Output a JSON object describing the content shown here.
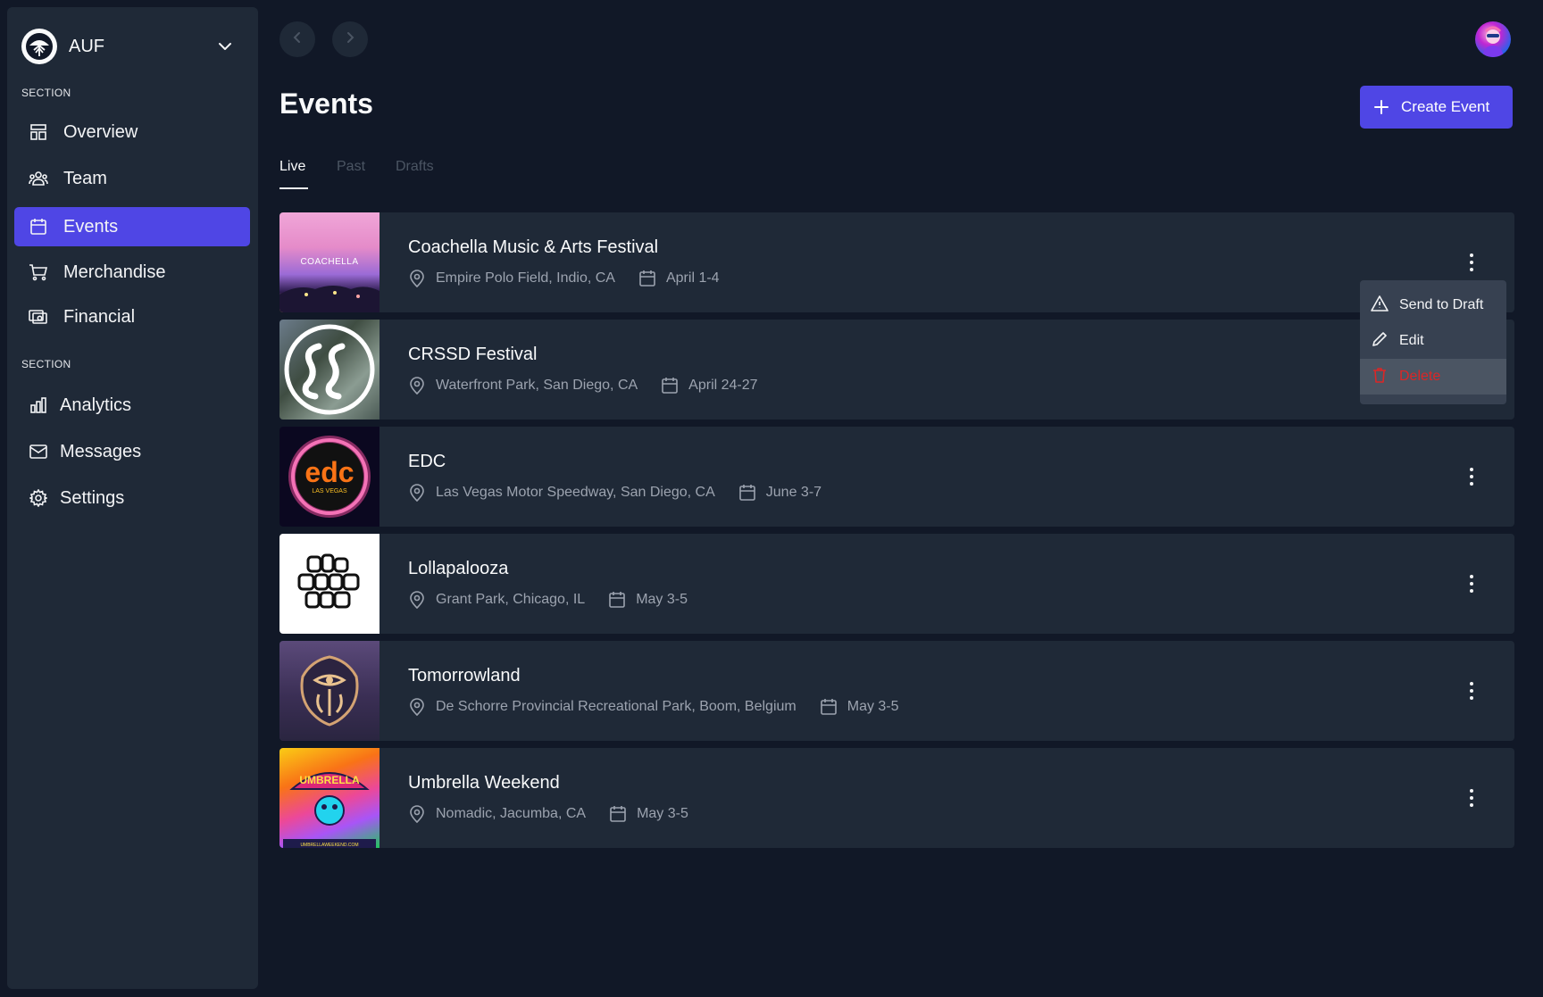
{
  "org": {
    "name": "AUF"
  },
  "sidebar": {
    "section1_label": "SECTION",
    "section2_label": "SECTION",
    "items": [
      {
        "label": "Overview",
        "icon": "layout-icon"
      },
      {
        "label": "Team",
        "icon": "team-icon"
      },
      {
        "label": "Events",
        "icon": "calendar-icon",
        "active": true
      },
      {
        "label": "Merchandise",
        "icon": "cart-icon"
      },
      {
        "label": "Financial",
        "icon": "cash-icon"
      },
      {
        "label": "Analytics",
        "icon": "chart-bar-icon"
      },
      {
        "label": "Messages",
        "icon": "envelope-icon"
      },
      {
        "label": "Settings",
        "icon": "gear-icon"
      }
    ]
  },
  "header": {
    "title": "Events",
    "create_label": "Create Event"
  },
  "tabs": [
    {
      "label": "Live",
      "active": true
    },
    {
      "label": "Past",
      "active": false
    },
    {
      "label": "Drafts",
      "active": false
    }
  ],
  "events": [
    {
      "name": "Coachella Music & Arts Festival",
      "location": "Empire Polo Field, Indio, CA",
      "date": "April 1-4",
      "logo_text": "COACHELLA"
    },
    {
      "name": "CRSSD Festival",
      "location": "Waterfront Park, San Diego, CA",
      "date": "April 24-27"
    },
    {
      "name": "EDC",
      "location": "Las Vegas Motor Speedway, San Diego, CA",
      "date": "June 3-7",
      "logo_text": "edc",
      "logo_subtext": "LAS VEGAS"
    },
    {
      "name": "Lollapalooza",
      "location": "Grant Park, Chicago, IL",
      "date": "May 3-5",
      "logo_text": "lolla palo oza"
    },
    {
      "name": "Tomorrowland",
      "location": "De Schorre Provincial Recreational Park, Boom, Belgium",
      "date": "May 3-5"
    },
    {
      "name": "Umbrella Weekend",
      "location": "Nomadic, Jacumba, CA",
      "date": "May 3-5",
      "logo_text": "UMBRELLA",
      "logo_subtext": "UMBRELLAWEEKEND.COM"
    }
  ],
  "menu": {
    "items": [
      {
        "label": "Send to Draft",
        "icon": "warning-icon"
      },
      {
        "label": "Edit",
        "icon": "pencil-icon"
      },
      {
        "label": "Delete",
        "icon": "trash-icon"
      }
    ]
  },
  "colors": {
    "background": "#111827",
    "panel": "#1f2937",
    "accent": "#4f46e5",
    "danger": "#dc2626",
    "muted_text": "#9ca3af"
  }
}
